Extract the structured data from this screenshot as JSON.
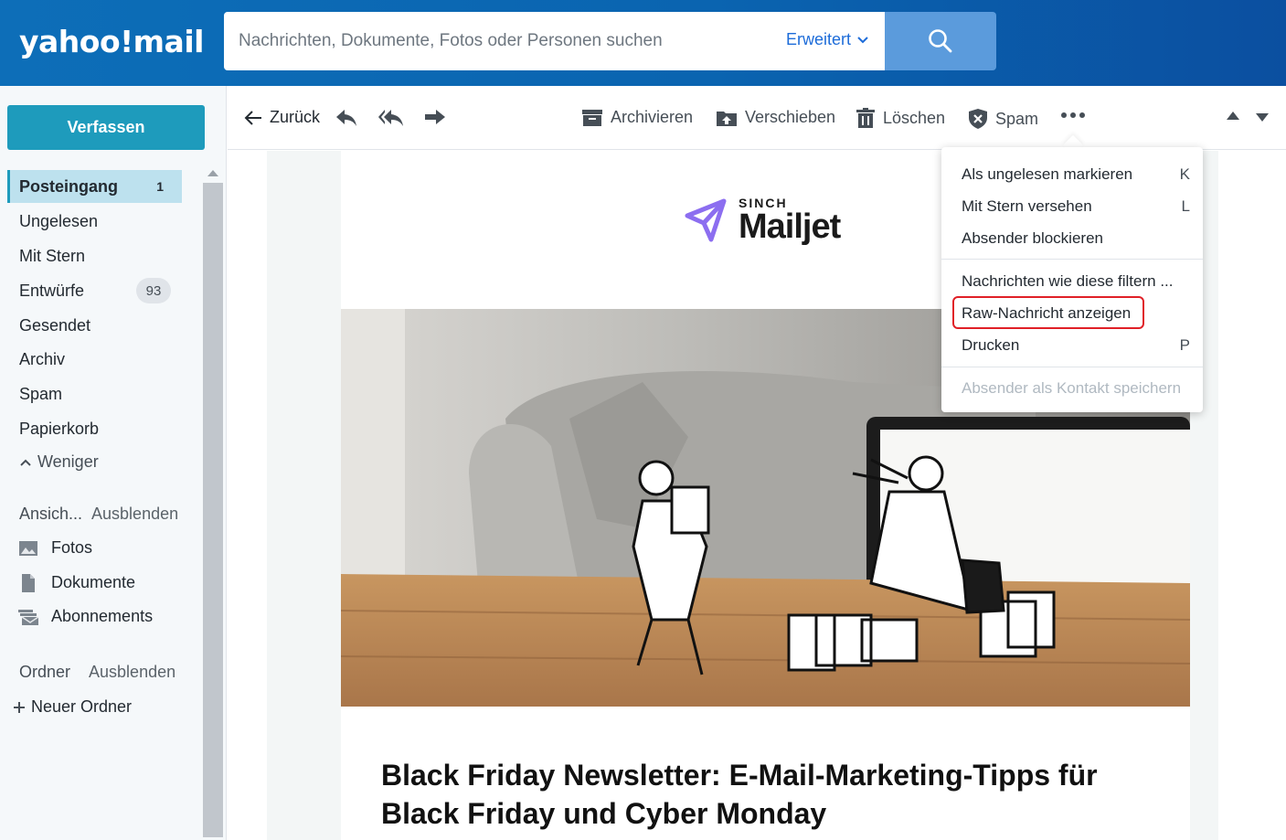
{
  "header": {
    "logo": "yahoo!mail",
    "search_placeholder": "Nachrichten, Dokumente, Fotos oder Personen suchen",
    "advanced_label": "Erweitert"
  },
  "sidebar": {
    "compose_label": "Verfassen",
    "folders": [
      {
        "label": "Posteingang",
        "count": "1"
      },
      {
        "label": "Ungelesen"
      },
      {
        "label": "Mit Stern"
      },
      {
        "label": "Entwürfe",
        "badge": "93"
      },
      {
        "label": "Gesendet"
      },
      {
        "label": "Archiv"
      },
      {
        "label": "Spam"
      },
      {
        "label": "Papierkorb"
      }
    ],
    "less_label": "Weniger",
    "views_title": "Ansich...",
    "views_hide": "Ausblenden",
    "views": [
      {
        "label": "Fotos",
        "icon": "photo-icon"
      },
      {
        "label": "Dokumente",
        "icon": "document-icon"
      },
      {
        "label": "Abonnements",
        "icon": "subscriptions-icon"
      }
    ],
    "folders_title": "Ordner",
    "folders_hide": "Ausblenden",
    "new_folder_label": "Neuer Ordner"
  },
  "toolbar": {
    "back_label": "Zurück",
    "archive_label": "Archivieren",
    "move_label": "Verschieben",
    "delete_label": "Löschen",
    "spam_label": "Spam"
  },
  "menu": {
    "items": [
      {
        "label": "Als ungelesen markieren",
        "key": "K"
      },
      {
        "label": "Mit Stern versehen",
        "key": "L"
      },
      {
        "label": "Absender blockieren",
        "key": ""
      },
      {
        "label": "Nachrichten wie diese filtern ...",
        "key": ""
      },
      {
        "label": "Raw-Nachricht anzeigen",
        "key": ""
      },
      {
        "label": "Drucken",
        "key": "P"
      },
      {
        "label": "Absender als Kontakt speichern",
        "key": ""
      }
    ]
  },
  "email": {
    "brand_top": "SINCH",
    "brand_name": "Mailjet",
    "headline": "Black Friday Newsletter: E-Mail-Marketing-Tipps für Black Friday und Cyber Monday"
  },
  "colors": {
    "header_blue": "#0d6eb8",
    "compose_teal": "#1e9bbc",
    "highlight_red": "#e02027"
  }
}
